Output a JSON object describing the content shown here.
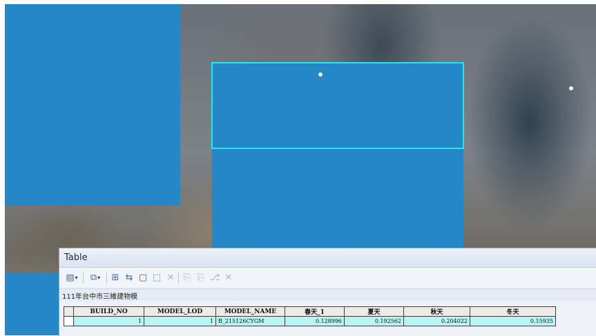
{
  "table_window": {
    "title": "Table",
    "layer_tab": "111年台中市三維建物模",
    "toolbar": [
      {
        "name": "table-options-icon",
        "glyph": "▤",
        "dropdown": true,
        "enabled": true
      },
      {
        "name": "related-tables-icon",
        "glyph": "⧉",
        "dropdown": true,
        "enabled": true
      },
      {
        "name": "select-by-attributes-icon",
        "glyph": "⊞",
        "dropdown": false,
        "enabled": true
      },
      {
        "name": "switch-selection-icon",
        "glyph": "⇆",
        "dropdown": false,
        "enabled": true
      },
      {
        "name": "clear-selection-icon",
        "glyph": "▢",
        "dropdown": false,
        "enabled": true
      },
      {
        "name": "zoom-to-selected-icon",
        "glyph": "⬚",
        "dropdown": false,
        "enabled": true
      },
      {
        "name": "delete-selected-icon",
        "glyph": "✕",
        "dropdown": false,
        "enabled": false
      },
      {
        "name": "copy-selected-icon",
        "glyph": "⎘",
        "dropdown": false,
        "enabled": false
      },
      {
        "name": "paste-icon",
        "glyph": "⎘",
        "dropdown": false,
        "enabled": false
      },
      {
        "name": "attach-icon",
        "glyph": "⎇",
        "dropdown": false,
        "enabled": false
      },
      {
        "name": "delete-field-icon",
        "glyph": "✕",
        "dropdown": false,
        "enabled": false
      }
    ],
    "columns": [
      "",
      "BUILD_NO",
      "MODEL_LOD",
      "MODEL_NAME",
      "春天_1",
      "夏天",
      "秋天",
      "冬天"
    ],
    "rows": [
      [
        "",
        "1",
        "1",
        "B_215126CYGM",
        "0.128996",
        "0.192562",
        "0.204022",
        "0.15935"
      ]
    ]
  },
  "colors": {
    "building_fill": "#2687c6",
    "selection_outline": "#22e6f0",
    "selected_row": "#b8f4f4"
  }
}
